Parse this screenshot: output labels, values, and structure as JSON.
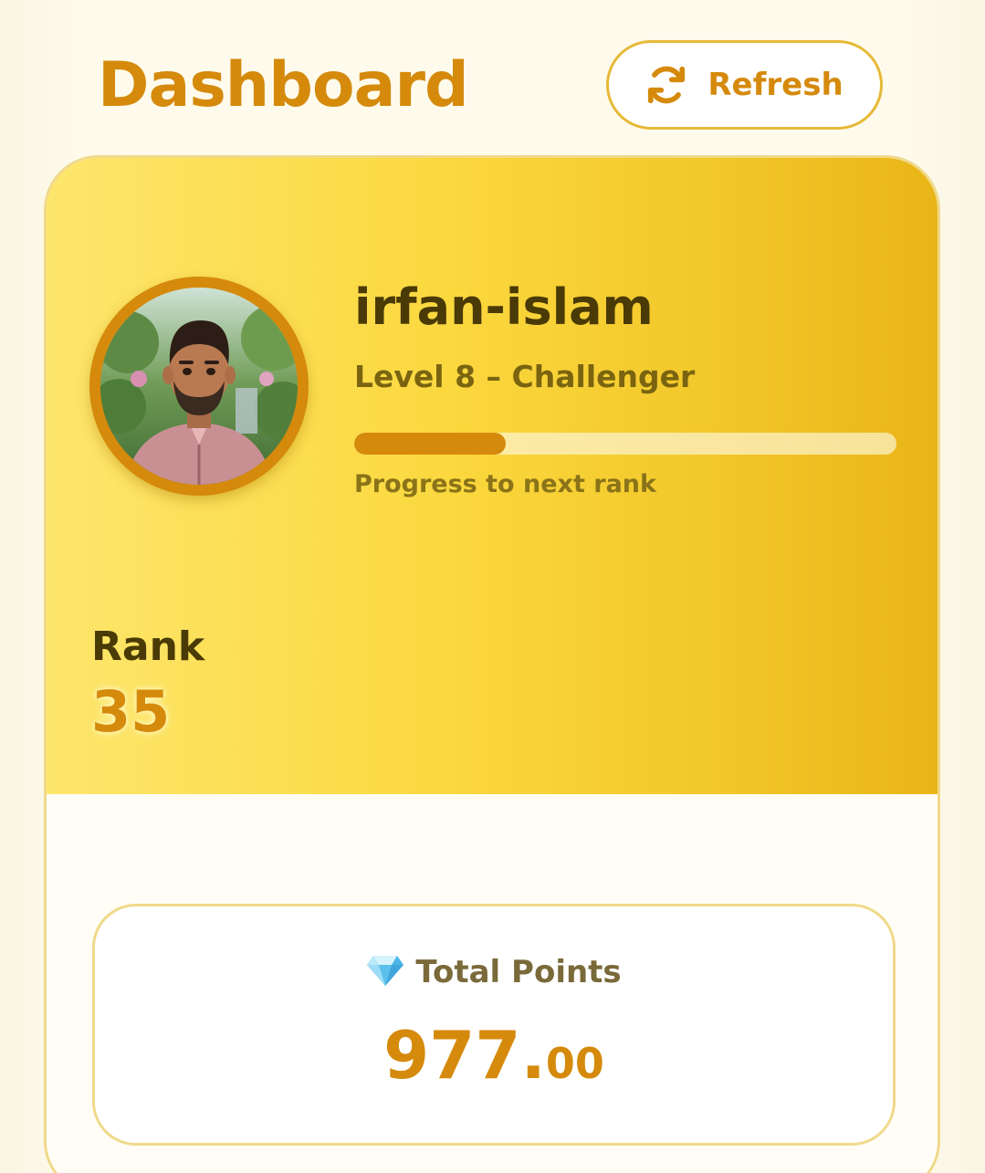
{
  "header": {
    "title": "Dashboard",
    "refresh_label": "Refresh",
    "refresh_icon": "refresh-icon"
  },
  "profile": {
    "username": "irfan-islam",
    "level": "Level 8 – Challenger",
    "progress_fraction": 0.28,
    "progress_caption": "Progress to next rank",
    "avatar": "avatar-image"
  },
  "rank": {
    "label": "Rank",
    "value": "35"
  },
  "points": {
    "icon": "diamond-icon",
    "title": "Total Points",
    "value_int": "977.",
    "value_dec": "00"
  },
  "colors": {
    "accent": "#d58a0c",
    "card_gradient_start": "#fde66c",
    "card_gradient_end": "#e9b517",
    "dark_text": "#4a3a06"
  }
}
